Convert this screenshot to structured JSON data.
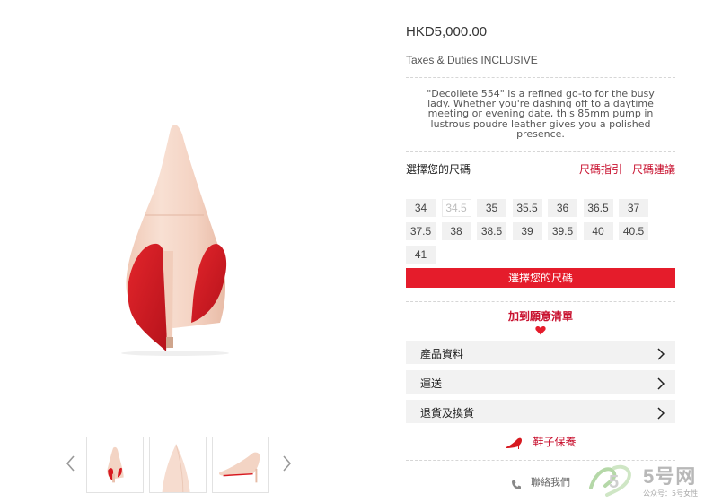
{
  "product": {
    "price": "HKD5,000.00",
    "tax_note": "Taxes & Duties INCLUSIVE",
    "description": "\"Decollete 554\" is a refined go-to for the busy lady. Whether you're dashing off to a daytime meeting or evening date, this 85mm pump in lustrous poudre leather gives you a polished presence."
  },
  "size_section": {
    "title": "選擇您的尺碼",
    "guide_link": "尺碼指引",
    "advice_link": "尺碼建議",
    "sizes": [
      {
        "label": "34",
        "available": true
      },
      {
        "label": "34.5",
        "available": false
      },
      {
        "label": "35",
        "available": true
      },
      {
        "label": "35.5",
        "available": true
      },
      {
        "label": "36",
        "available": true
      },
      {
        "label": "36.5",
        "available": true
      },
      {
        "label": "37",
        "available": true
      },
      {
        "label": "37.5",
        "available": true
      },
      {
        "label": "38",
        "available": true
      },
      {
        "label": "38.5",
        "available": true
      },
      {
        "label": "39",
        "available": true
      },
      {
        "label": "39.5",
        "available": true
      },
      {
        "label": "40",
        "available": true
      },
      {
        "label": "40.5",
        "available": true
      },
      {
        "label": "41",
        "available": true
      }
    ],
    "select_button": "選擇您的尺碼"
  },
  "wishlist": {
    "label": "加到願意清單",
    "icon": "heart-icon"
  },
  "accordion": [
    {
      "label": "產品資料",
      "icon": "chevron-right-icon"
    },
    {
      "label": "運送",
      "icon": "chevron-right-icon"
    },
    {
      "label": "退貨及換貨",
      "icon": "chevron-right-icon"
    }
  ],
  "shoe_care": {
    "label": "鞋子保養",
    "icon": "red-pump-icon"
  },
  "contact": {
    "label": "聯絡我們",
    "icon": "phone-icon"
  },
  "gallery": {
    "prev_icon": "chevron-left-icon",
    "next_icon": "chevron-right-icon",
    "thumbnails": [
      "back-view",
      "toe-closeup",
      "side-view"
    ]
  },
  "watermark": {
    "brand": "5号网",
    "subtitle": "公众号：5号女性"
  },
  "colors": {
    "accent_red": "#e51c2b",
    "link_red": "#c8102e",
    "shoe_nude": "#f3d4c4",
    "sole_red": "#d71920"
  }
}
